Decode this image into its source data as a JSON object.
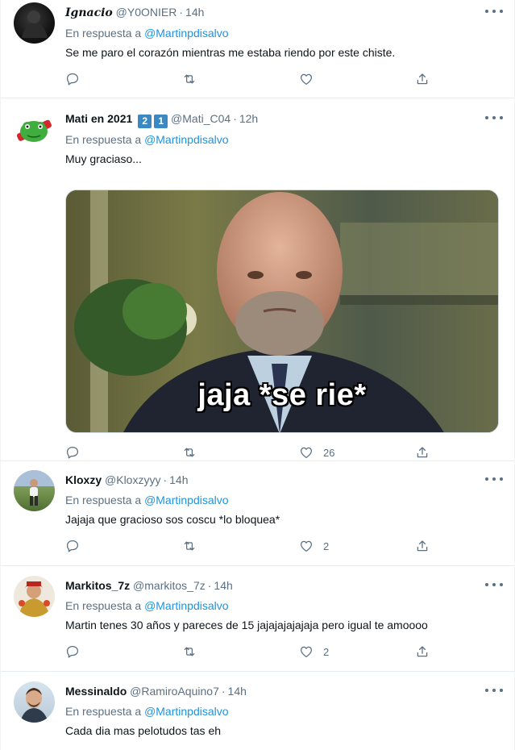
{
  "colors": {
    "link": "#1b95e0",
    "muted": "#5b7083",
    "text": "#0f1419",
    "divider": "#e6ecf0"
  },
  "tweets": [
    {
      "name": "Ignacio",
      "handle": "@Y0ONIER",
      "time": "14h",
      "reply_prefix": "En respuesta a",
      "reply_to": "@Martinpdisalvo",
      "text": "Se me paro el corazón mientras me estaba riendo por este chiste.",
      "like_count": ""
    },
    {
      "name": "Mati en 2021",
      "badges": [
        "2",
        "1"
      ],
      "handle": "@Mati_C04",
      "time": "12h",
      "reply_prefix": "En respuesta a",
      "reply_to": "@Martinpdisalvo",
      "text": "Muy graciaso...",
      "media_caption": "jaja *se rie*",
      "like_count": "26"
    },
    {
      "name": "Kloxzy",
      "handle": "@Kloxzyyy",
      "time": "14h",
      "reply_prefix": "En respuesta a",
      "reply_to": "@Martinpdisalvo",
      "text": "Jajaja que gracioso sos coscu *lo bloquea*",
      "like_count": "2"
    },
    {
      "name": "Markitos_7z",
      "handle": "@markitos_7z",
      "time": "14h",
      "reply_prefix": "En respuesta a",
      "reply_to": "@Martinpdisalvo",
      "text": "Martin tenes 30 años y pareces de 15 jajajajajajaja pero igual te amoooo",
      "like_count": "2"
    },
    {
      "name": "Messinaldo",
      "handle": "@RamiroAquino7",
      "time": "14h",
      "reply_prefix": "En respuesta a",
      "reply_to": "@Martinpdisalvo",
      "text": "Cada dia mas pelotudos tas eh"
    }
  ],
  "icons": {
    "reply": "reply-icon",
    "retweet": "retweet-icon",
    "like": "heart-icon",
    "share": "share-icon",
    "more": "more-icon"
  }
}
